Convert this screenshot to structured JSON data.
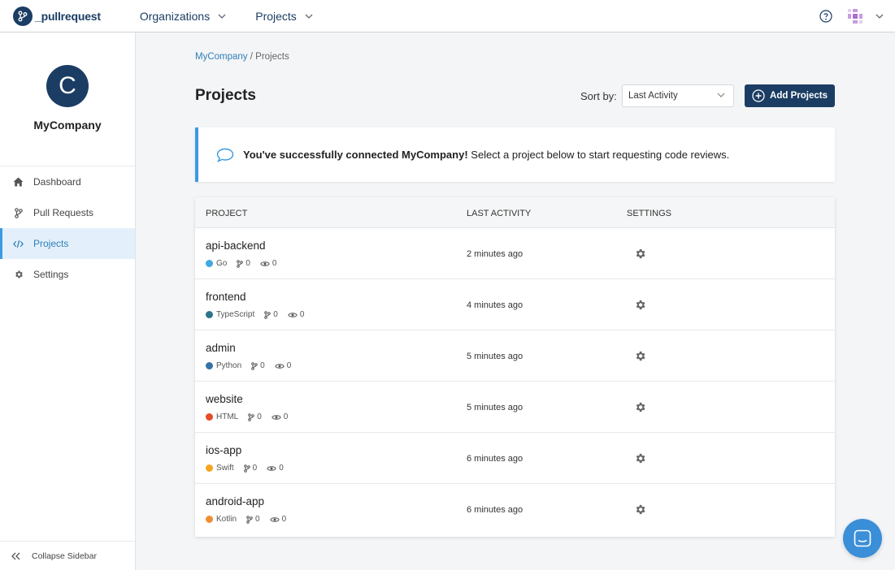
{
  "app": {
    "logo_text": "_pullrequest",
    "nav": [
      {
        "label": "Organizations"
      },
      {
        "label": "Projects"
      }
    ]
  },
  "sidebar": {
    "org_initial": "C",
    "org_name": "MyCompany",
    "items": [
      {
        "label": "Dashboard",
        "icon": "home-icon"
      },
      {
        "label": "Pull Requests",
        "icon": "branch-icon"
      },
      {
        "label": "Projects",
        "icon": "code-icon",
        "active": true
      },
      {
        "label": "Settings",
        "icon": "gear-icon"
      }
    ],
    "collapse_label": "Collapse Sidebar"
  },
  "breadcrumb": {
    "parent": "MyCompany",
    "separator": " / ",
    "current": "Projects"
  },
  "page": {
    "title": "Projects",
    "sort_label": "Sort by:",
    "sort_value": "Last Activity",
    "add_button": "Add Projects"
  },
  "banner": {
    "bold": "You've successfully connected MyCompany!",
    "text": " Select a project below to start requesting code reviews."
  },
  "table": {
    "headers": {
      "project": "PROJECT",
      "activity": "LAST ACTIVITY",
      "settings": "SETTINGS"
    },
    "rows": [
      {
        "name": "api-backend",
        "language": "Go",
        "color": "#3fa9e0",
        "prs": "0",
        "reviews": "0",
        "activity": "2 minutes ago"
      },
      {
        "name": "frontend",
        "language": "TypeScript",
        "color": "#2b7489",
        "prs": "0",
        "reviews": "0",
        "activity": "4 minutes ago"
      },
      {
        "name": "admin",
        "language": "Python",
        "color": "#3572a5",
        "prs": "0",
        "reviews": "0",
        "activity": "5 minutes ago"
      },
      {
        "name": "website",
        "language": "HTML",
        "color": "#e34c26",
        "prs": "0",
        "reviews": "0",
        "activity": "5 minutes ago"
      },
      {
        "name": "ios-app",
        "language": "Swift",
        "color": "#f5a623",
        "prs": "0",
        "reviews": "0",
        "activity": "6 minutes ago"
      },
      {
        "name": "android-app",
        "language": "Kotlin",
        "color": "#f18e33",
        "prs": "0",
        "reviews": "0",
        "activity": "6 minutes ago"
      }
    ]
  },
  "colors": {
    "brand": "#1b3d63",
    "accent": "#3b9ae1",
    "link": "#2f7fb8"
  }
}
